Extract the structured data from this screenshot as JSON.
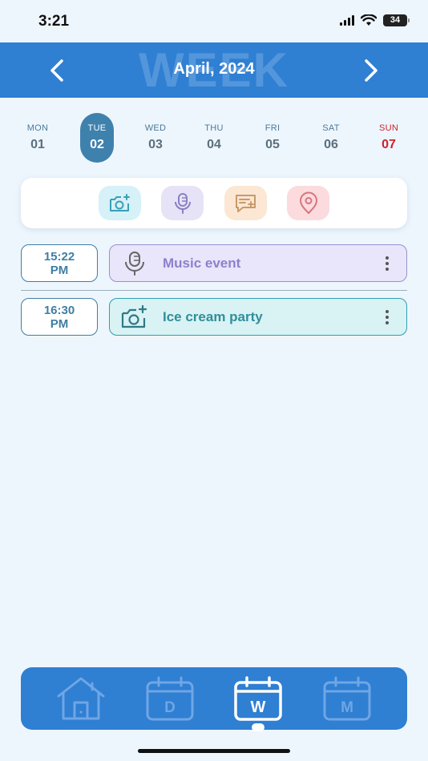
{
  "status_bar": {
    "time": "3:21",
    "battery": "34"
  },
  "header": {
    "watermark": "WEEK",
    "title": "April, 2024"
  },
  "days": [
    {
      "name": "MON",
      "num": "01"
    },
    {
      "name": "TUE",
      "num": "02"
    },
    {
      "name": "WED",
      "num": "03"
    },
    {
      "name": "THU",
      "num": "04"
    },
    {
      "name": "FRI",
      "num": "05"
    },
    {
      "name": "SAT",
      "num": "06"
    },
    {
      "name": "SUN",
      "num": "07"
    }
  ],
  "events": [
    {
      "time_line1": "15:22",
      "time_line2": "PM",
      "title": "Music event",
      "type": "audio-icon"
    },
    {
      "time_line1": "16:30",
      "time_line2": "PM",
      "title": "Ice cream party",
      "type": "camera-icon"
    }
  ],
  "bottom_nav": {
    "day_letter": "D",
    "week_letter": "W",
    "month_letter": "M"
  },
  "colors": {
    "primary": "#2f7fd3",
    "selected_day": "#3f81ad",
    "sunday": "#d0212a",
    "background": "#eef6fd"
  }
}
